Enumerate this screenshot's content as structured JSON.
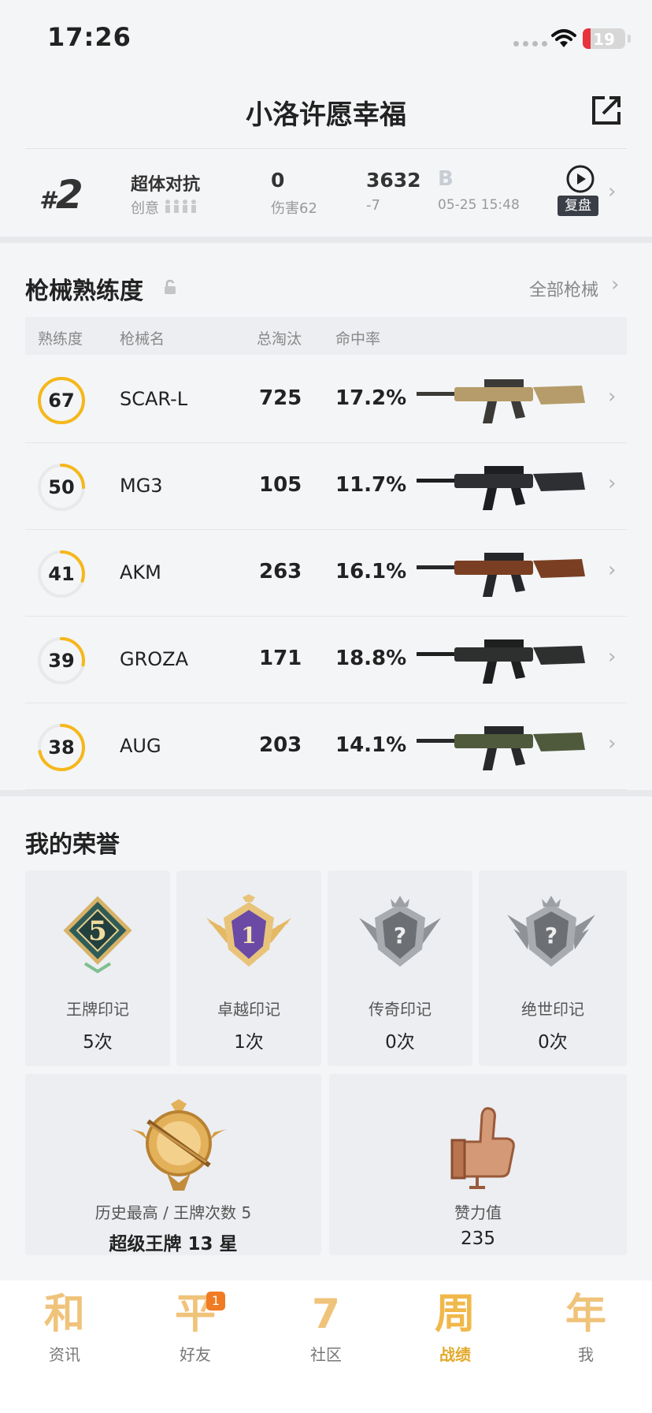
{
  "status_bar": {
    "time": "17:26",
    "battery": "19",
    "battery_level": 0.19
  },
  "header": {
    "title": "小洛许愿幸福",
    "share_icon": "share-out-icon"
  },
  "match": {
    "rank_hash": "#",
    "rank": "2",
    "mode": "超体对抗",
    "sub": "创意",
    "kills": "0",
    "damage": "伤害62",
    "score": "3632",
    "score_delta": "-7",
    "tier": "B",
    "time": "05-25 15:48",
    "replay_label": "复盘"
  },
  "weapons": {
    "title": "枪械熟练度",
    "all_label": "全部枪械",
    "headers": [
      "熟练度",
      "枪械名",
      "总淘汰",
      "命中率"
    ],
    "rows": [
      {
        "proficiency": "67",
        "name": "SCAR-L",
        "kills": "725",
        "rate": "17.2%",
        "fill": 1.0,
        "icon": "scar-l-rifle-image"
      },
      {
        "proficiency": "50",
        "name": "MG3",
        "kills": "105",
        "rate": "11.7%",
        "fill": 0.25,
        "icon": "mg3-machine-gun-image"
      },
      {
        "proficiency": "41",
        "name": "AKM",
        "kills": "263",
        "rate": "16.1%",
        "fill": 0.3,
        "icon": "akm-rifle-image"
      },
      {
        "proficiency": "39",
        "name": "GROZA",
        "kills": "171",
        "rate": "18.8%",
        "fill": 0.28,
        "icon": "groza-rifle-image"
      },
      {
        "proficiency": "38",
        "name": "AUG",
        "kills": "203",
        "rate": "14.1%",
        "fill": 0.72,
        "icon": "aug-rifle-image"
      }
    ]
  },
  "honors": {
    "title": "我的荣誉",
    "badges": [
      {
        "label": "王牌印记",
        "count": "5次",
        "badge_text": "5"
      },
      {
        "label": "卓越印记",
        "count": "1次",
        "badge_text": "1"
      },
      {
        "label": "传奇印记",
        "count": "0次",
        "badge_text": "?"
      },
      {
        "label": "绝世印记",
        "count": "0次",
        "badge_text": "?"
      }
    ],
    "history": {
      "label": "历史最高 / 王牌次数 5",
      "value": "超级王牌 13 星"
    },
    "likes": {
      "label": "赞力值",
      "value": "235"
    }
  },
  "tabbar": {
    "tabs": [
      {
        "glyph": "和",
        "label": "资讯"
      },
      {
        "glyph": "平",
        "label": "好友",
        "badge": "1"
      },
      {
        "glyph": "7",
        "label": "社区"
      },
      {
        "glyph": "周",
        "label": "战绩"
      },
      {
        "glyph": "年",
        "label": "我"
      }
    ]
  },
  "colors": {
    "accent": "#f5b81b",
    "ring_track": "#e9e9ec",
    "active_tab": "#e2a92a"
  }
}
